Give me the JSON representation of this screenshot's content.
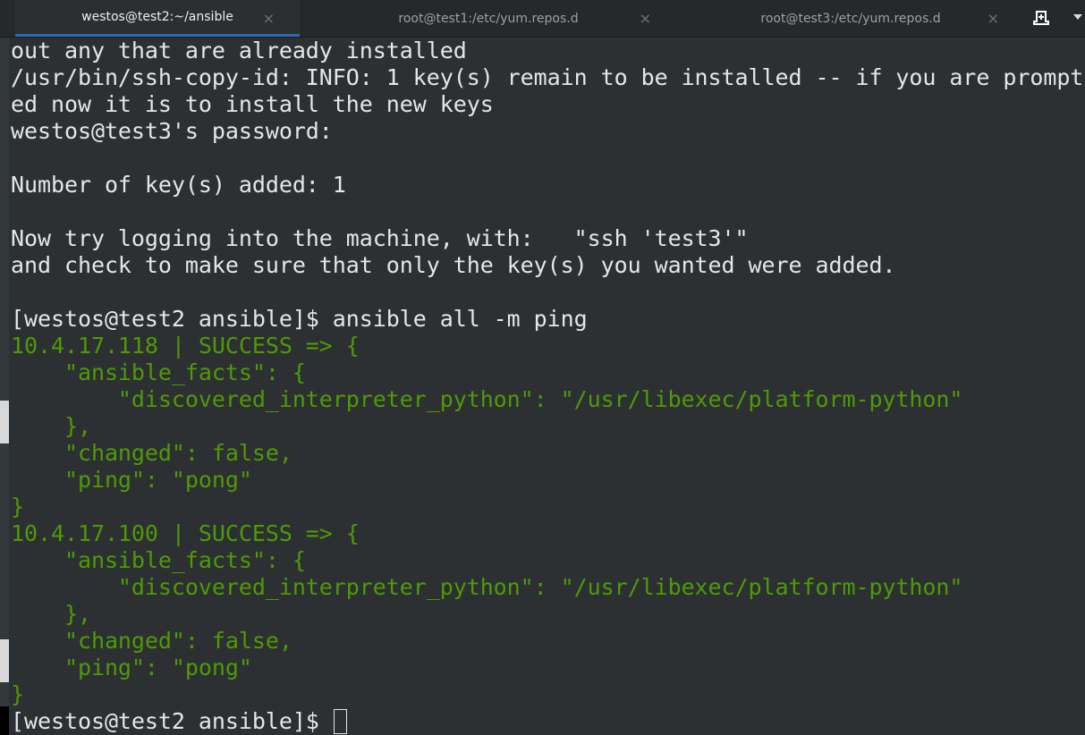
{
  "tabs": [
    {
      "label": "westos@test2:~/ansible",
      "active": true
    },
    {
      "label": "root@test1:/etc/yum.repos.d",
      "active": false
    },
    {
      "label": "root@test3:/etc/yum.repos.d",
      "active": false
    }
  ],
  "icons": {
    "close": "×",
    "new_tab": "new-tab-icon",
    "menu": "chevron-down-icon"
  },
  "colors": {
    "background": "#2d3032",
    "text": "#e6e6e6",
    "success": "#4e9a06",
    "tab_accent": "#2a6bb5"
  },
  "terminal": {
    "lines": [
      "out any that are already installed",
      "/usr/bin/ssh-copy-id: INFO: 1 key(s) remain to be installed -- if you are prompt",
      "ed now it is to install the new keys",
      "westos@test3's password: ",
      "",
      "Number of key(s) added: 1",
      "",
      "Now try logging into the machine, with:   \"ssh 'test3'\"",
      "and check to make sure that only the key(s) you wanted were added.",
      "",
      "[westos@test2 ansible]$ ansible all -m ping",
      "10.4.17.118 | SUCCESS => {",
      "    \"ansible_facts\": {",
      "        \"discovered_interpreter_python\": \"/usr/libexec/platform-python\"",
      "    },",
      "    \"changed\": false,",
      "    \"ping\": \"pong\"",
      "}",
      "10.4.17.100 | SUCCESS => {",
      "    \"ansible_facts\": {",
      "        \"discovered_interpreter_python\": \"/usr/libexec/platform-python\"",
      "    },",
      "    \"changed\": false,",
      "    \"ping\": \"pong\"",
      "}",
      "[westos@test2 ansible]$ "
    ]
  }
}
